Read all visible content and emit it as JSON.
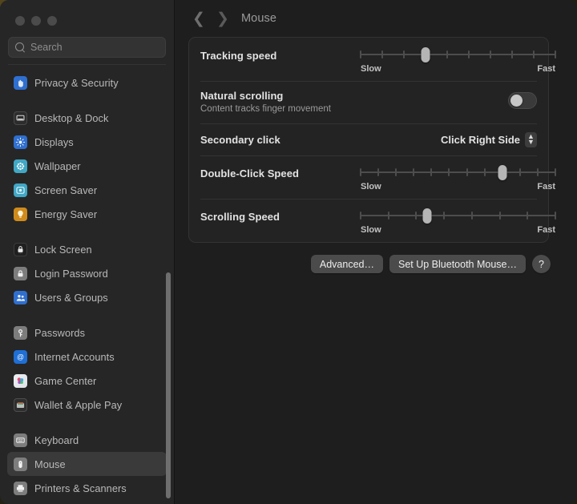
{
  "window": {
    "traffic_lights": [
      "close",
      "minimize",
      "zoom"
    ]
  },
  "sidebar": {
    "search": {
      "placeholder": "Search",
      "value": ""
    },
    "items": [
      {
        "label": "Privacy & Security",
        "icon": "hand-privacy-icon",
        "selected": false,
        "gap_after": true
      },
      {
        "label": "Desktop & Dock",
        "icon": "desktop-dock-icon",
        "selected": false
      },
      {
        "label": "Displays",
        "icon": "displays-icon",
        "selected": false
      },
      {
        "label": "Wallpaper",
        "icon": "wallpaper-icon",
        "selected": false
      },
      {
        "label": "Screen Saver",
        "icon": "screen-saver-icon",
        "selected": false
      },
      {
        "label": "Energy Saver",
        "icon": "energy-saver-icon",
        "selected": false,
        "gap_after": true
      },
      {
        "label": "Lock Screen",
        "icon": "lock-screen-icon",
        "selected": false
      },
      {
        "label": "Login Password",
        "icon": "login-password-icon",
        "selected": false
      },
      {
        "label": "Users & Groups",
        "icon": "users-groups-icon",
        "selected": false,
        "gap_after": true
      },
      {
        "label": "Passwords",
        "icon": "passwords-key-icon",
        "selected": false
      },
      {
        "label": "Internet Accounts",
        "icon": "internet-accounts-icon",
        "selected": false
      },
      {
        "label": "Game Center",
        "icon": "game-center-icon",
        "selected": false
      },
      {
        "label": "Wallet & Apple Pay",
        "icon": "wallet-apple-pay-icon",
        "selected": false,
        "gap_after": true
      },
      {
        "label": "Keyboard",
        "icon": "keyboard-icon",
        "selected": false
      },
      {
        "label": "Mouse",
        "icon": "mouse-icon",
        "selected": true
      },
      {
        "label": "Printers & Scanners",
        "icon": "printers-scanners-icon",
        "selected": false
      }
    ]
  },
  "toolbar": {
    "back_icon": "chevron-left-icon",
    "forward_icon": "chevron-right-icon",
    "title": "Mouse"
  },
  "settings": {
    "tracking_speed": {
      "label": "Tracking speed",
      "min_label": "Slow",
      "max_label": "Fast",
      "ticks": 10,
      "value_index": 3
    },
    "natural_scrolling": {
      "label": "Natural scrolling",
      "description": "Content tracks finger movement",
      "state": "off"
    },
    "secondary_click": {
      "label": "Secondary click",
      "value": "Click Right Side"
    },
    "double_click_speed": {
      "label": "Double-Click Speed",
      "min_label": "Slow",
      "max_label": "Fast",
      "ticks": 12,
      "value_index": 8
    },
    "scrolling_speed": {
      "label": "Scrolling Speed",
      "min_label": "Slow",
      "max_label": "Fast",
      "ticks": 8,
      "value_index": 2.4
    }
  },
  "buttons": {
    "advanced": "Advanced…",
    "bluetooth": "Set Up Bluetooth Mouse…",
    "help": "?"
  },
  "colors": {
    "window_bg": "#1e1e1e",
    "sidebar_bg": "#262626",
    "card_bg": "#232323",
    "accent_blue": "#2f6fd0",
    "selected_row": "#3a3a3a"
  }
}
